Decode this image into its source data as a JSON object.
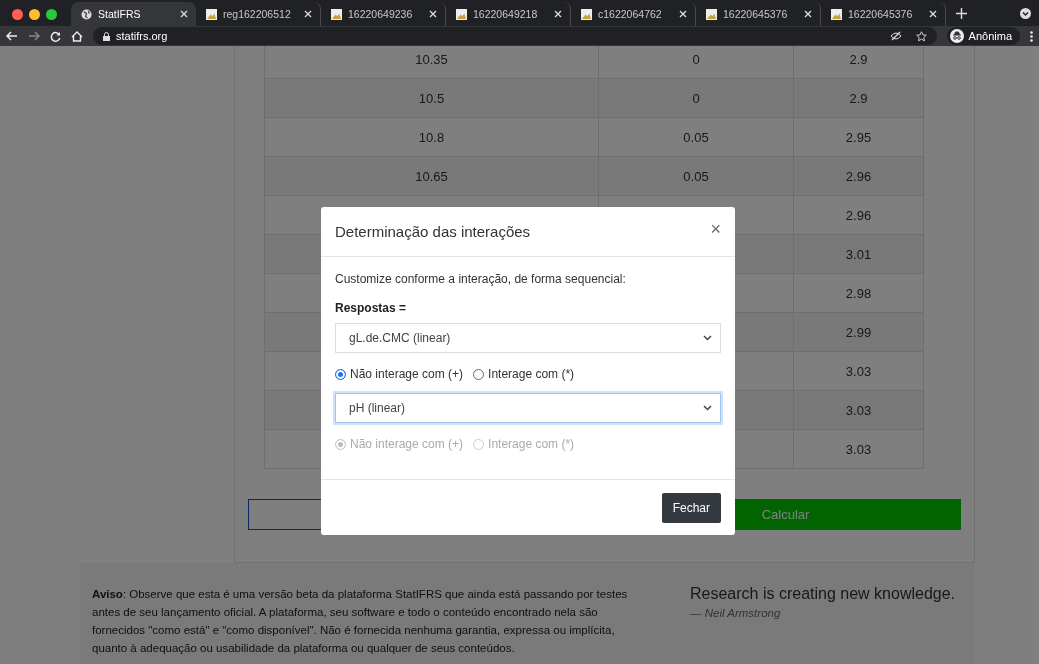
{
  "browser": {
    "tabs": [
      {
        "title": "StatIFRS",
        "selected": true,
        "kind": "globe"
      },
      {
        "title": "reg162206512",
        "selected": false,
        "kind": "image"
      },
      {
        "title": "16220649236",
        "selected": false,
        "kind": "image"
      },
      {
        "title": "16220649218",
        "selected": false,
        "kind": "image"
      },
      {
        "title": "c1622064762",
        "selected": false,
        "kind": "image"
      },
      {
        "title": "16220645376",
        "selected": false,
        "kind": "image"
      },
      {
        "title": "16220645376",
        "selected": false,
        "kind": "image"
      }
    ],
    "url": "statifrs.org",
    "profile": "Anônima"
  },
  "table": {
    "rows": [
      {
        "column_1": "10.35",
        "column_2": "0",
        "column_3": "2.9"
      },
      {
        "column_1": "10.5",
        "column_2": "0",
        "column_3": "2.9"
      },
      {
        "column_1": "10.8",
        "column_2": "0.05",
        "column_3": "2.95"
      },
      {
        "column_1": "10.65",
        "column_2": "0.05",
        "column_3": "2.96"
      },
      {
        "column_3": "2.96"
      },
      {
        "column_3": "3.01"
      },
      {
        "column_3": "2.98"
      },
      {
        "column_3": "2.99"
      },
      {
        "column_3": "3.03"
      },
      {
        "column_3": "3.03"
      },
      {
        "column_3": "3.03"
      }
    ]
  },
  "actions": {
    "calculate": "Calcular"
  },
  "footer": {
    "notice": "**Aviso**: Observe que esta é uma versão beta da plataforma StatIFRS que ainda está passando por testes antes de seu lançamento oficial. A plataforma, seu software e todo o conteúdo encontrado nela são fornecidos \"como está\" e \"como disponível\". Não é fornecida nenhuma garantia, expressa ou implícita, quanto à adequação ou usabilidade da plataforma ou qualquer de seus conteúdos.",
    "quote": "Research is creating new knowledge.",
    "quote_author": "— Neil Armstrong"
  },
  "modal": {
    "title": "Determinação das interações",
    "close": "×",
    "intro": "Customize conforme a interação, de forma sequencial:",
    "responses_label": "Respostas =",
    "groups": [
      {
        "kind": "select",
        "value": "gL.de.CMC (linear)",
        "focused": false
      },
      {
        "kind": "radios",
        "disabled": false,
        "options": [
          {
            "label": "Não interage com (+)",
            "selected": true
          },
          {
            "label": "Interage com (*)",
            "selected": false
          }
        ]
      },
      {
        "kind": "select",
        "value": "pH (linear)",
        "focused": true
      },
      {
        "kind": "radios",
        "disabled": true,
        "options": [
          {
            "label": "Não interage com (+)",
            "selected": true
          },
          {
            "label": "Interage com (*)",
            "selected": false
          }
        ]
      }
    ],
    "close_button": "Fechar"
  }
}
